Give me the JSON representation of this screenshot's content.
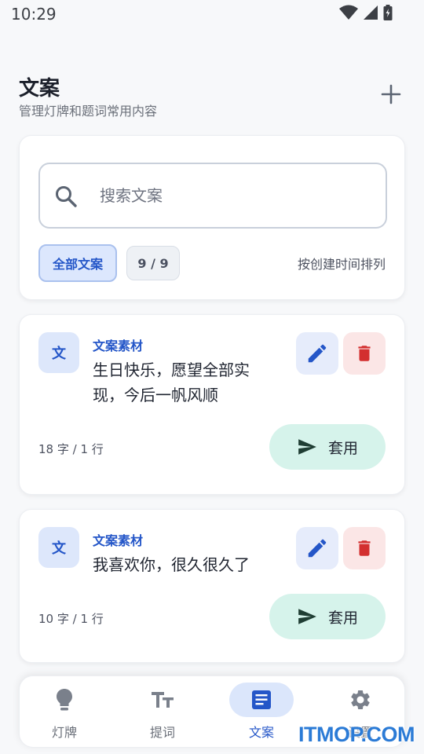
{
  "status_bar": {
    "time": "10:29"
  },
  "header": {
    "title": "文案",
    "subtitle": "管理灯牌和题词常用内容"
  },
  "search": {
    "placeholder": "搜索文案",
    "value": ""
  },
  "filters": {
    "all_label": "全部文案",
    "count_label": "9 / 9",
    "sort_label": "按创建时间排列"
  },
  "cards": [
    {
      "avatar": "文",
      "category": "文案素材",
      "text": "生日快乐，愿望全部实现，今后一帆风顺",
      "stats": "18 字 / 1 行",
      "apply_label": "套用"
    },
    {
      "avatar": "文",
      "category": "文案素材",
      "text": "我喜欢你，很久很久了",
      "stats": "10 字 / 1 行",
      "apply_label": "套用"
    }
  ],
  "nav": {
    "items": [
      {
        "label": "灯牌",
        "icon": "lightbulb-icon"
      },
      {
        "label": "提词",
        "icon": "text-size-icon"
      },
      {
        "label": "文案",
        "icon": "document-icon",
        "active": true
      },
      {
        "label": "设置",
        "icon": "gear-icon"
      }
    ]
  },
  "colors": {
    "accent": "#2456c8",
    "accent_light": "#dce7fd",
    "delete": "#d32f2f",
    "apply_bg": "#d6f3eb",
    "apply_icon": "#1f3d33"
  },
  "watermark": "ITMOP.COM"
}
